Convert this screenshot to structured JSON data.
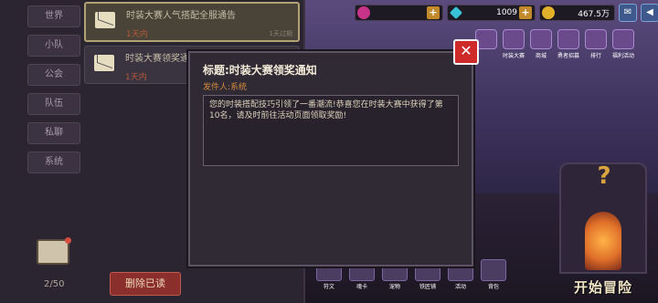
{
  "top_bar": {
    "hearts": "",
    "gems": "1009",
    "coins": "467.5万",
    "plus": "+"
  },
  "icons_row": [
    "",
    "时装大赛",
    "商城",
    "勇者招募",
    "排行",
    "福利活动"
  ],
  "dock": [
    "符文",
    "魂卡",
    "宠物",
    "铁匠铺",
    "活动",
    "背包"
  ],
  "start_adventure": "开始冒险",
  "mail_panel": {
    "tabs": [
      "世界",
      "小队",
      "公会",
      "队伍",
      "私聊",
      "系统"
    ],
    "items": [
      {
        "title": "时装大赛人气搭配全服通告",
        "days": "1天内",
        "expire": "1天过期"
      },
      {
        "title": "时装大赛领奖通知",
        "days": "1天内",
        "expire": ""
      }
    ],
    "count": "2/50",
    "delete_read": "删除已读"
  },
  "dialog": {
    "title": "标题:时装大赛领奖通知",
    "sender": "发件人:系统",
    "body": "您的时装搭配技巧引领了一番潮流!恭喜您在时装大赛中获得了第10名，请及时前往活动页面领取奖励!",
    "close": "✕"
  }
}
